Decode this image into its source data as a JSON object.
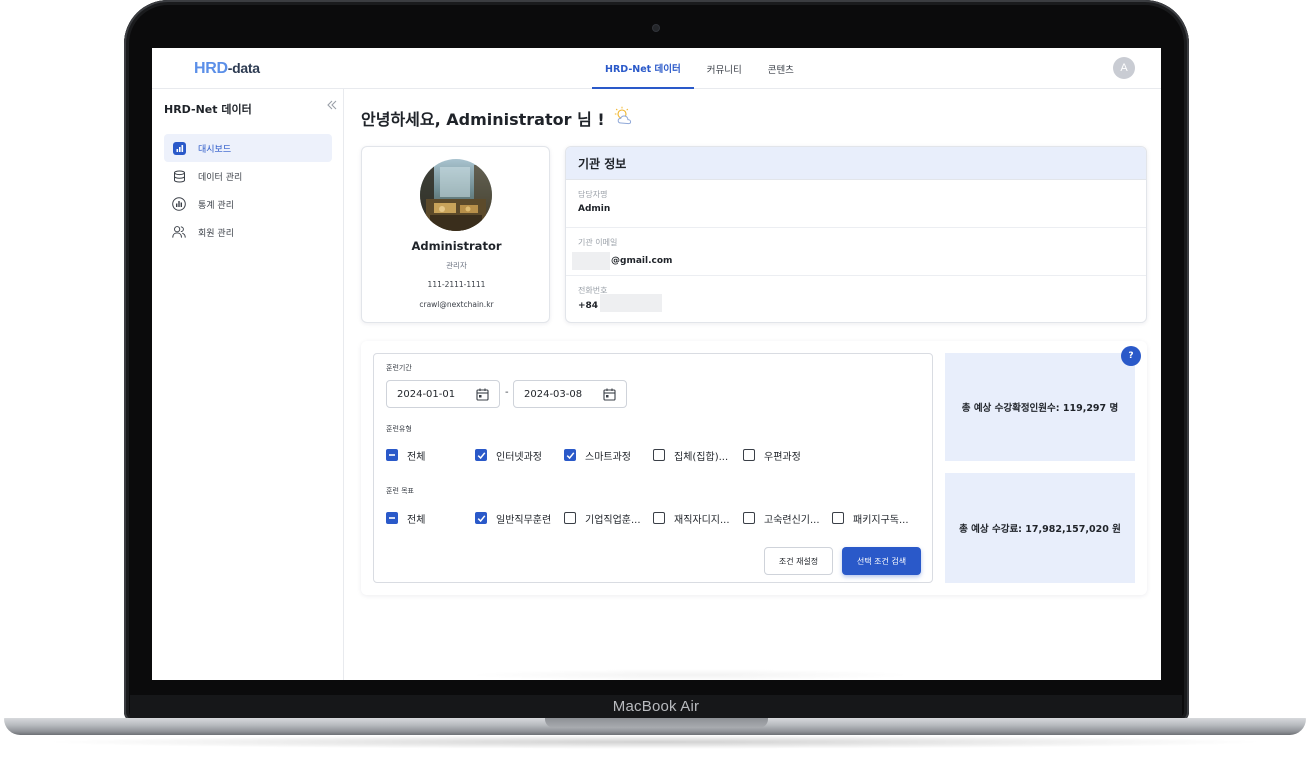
{
  "device": {
    "label": "MacBook Air"
  },
  "app": {
    "logo": {
      "part_a": "HRD",
      "part_b": "-data"
    },
    "nav_tabs": [
      {
        "label": "HRD-Net 데이터",
        "active": true
      },
      {
        "label": "커뮤니티",
        "active": false
      },
      {
        "label": "콘텐츠",
        "active": false
      }
    ],
    "avatar_initial": "A"
  },
  "sidebar": {
    "title": "HRD-Net 데이터",
    "collapse_icon": "double-chevron-left-icon",
    "items": [
      {
        "label": "대시보드",
        "icon": "bar-chart-icon",
        "active": true
      },
      {
        "label": "데이터 관리",
        "icon": "database-icon",
        "active": false
      },
      {
        "label": "통계 관리",
        "icon": "statistics-icon",
        "active": false
      },
      {
        "label": "회원 관리",
        "icon": "users-icon",
        "active": false
      }
    ]
  },
  "main": {
    "greeting": "안녕하세요, Administrator 님 !",
    "greeting_icon": "sun-cloud-icon",
    "profile": {
      "name": "Administrator",
      "role": "관리자",
      "phone": "111-2111-1111",
      "email": "crawl@nextchain.kr"
    },
    "org_info": {
      "title": "기관 정보",
      "manager_label": "담당자명",
      "manager_value": "Admin",
      "email_label": "기관 이메일",
      "email_value": "@gmail.com",
      "phone_label": "전화번호",
      "phone_value": "+84"
    },
    "filter": {
      "period_label": "훈련기간",
      "start_date": "2024-01-01",
      "end_date": "2024-03-08",
      "date_separator": "-",
      "type_label": "훈련유형",
      "type_options": [
        {
          "label": "전체",
          "state": "mixed"
        },
        {
          "label": "인터넷과정",
          "state": "checked"
        },
        {
          "label": "스마트과정",
          "state": "checked"
        },
        {
          "label": "집체(집합)...",
          "state": "empty"
        },
        {
          "label": "우편과정",
          "state": "empty"
        }
      ],
      "goal_label": "훈련 목표",
      "goal_options": [
        {
          "label": "전체",
          "state": "mixed"
        },
        {
          "label": "일반직무훈련",
          "state": "checked"
        },
        {
          "label": "기업직업훈...",
          "state": "empty"
        },
        {
          "label": "재직자디지...",
          "state": "empty"
        },
        {
          "label": "고숙련신기...",
          "state": "empty"
        },
        {
          "label": "패키지구독...",
          "state": "empty"
        }
      ],
      "reset_label": "조건 재설정",
      "search_label": "선택 조건 검색"
    },
    "stats": {
      "help_label": "?",
      "expected_students": "총 예상 수강확정인원수: 119,297 명",
      "expected_fee": "총 예상 수강료: 17,982,157,020 원"
    },
    "colors": {
      "accent": "#2a59c9",
      "accent_light": "#e8eefb"
    }
  }
}
